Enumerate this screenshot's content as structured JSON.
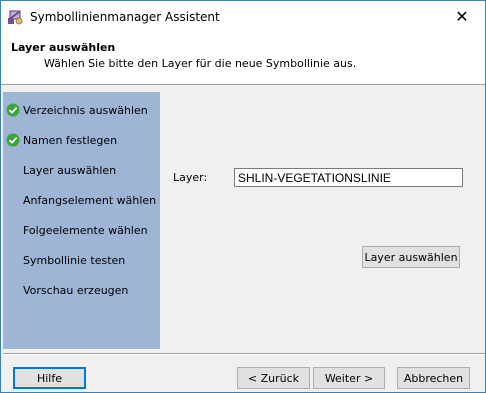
{
  "window": {
    "title": "Symbollinienmanager Assistent",
    "close_glyph": "✕"
  },
  "header": {
    "title": "Layer auswählen",
    "subtitle": "Wählen Sie bitte den Layer für die neue Symbollinie aus."
  },
  "steps": [
    {
      "label": "Verzeichnis auswählen",
      "completed": true
    },
    {
      "label": "Namen festlegen",
      "completed": true
    },
    {
      "label": "Layer auswählen",
      "completed": false
    },
    {
      "label": "Anfangselement wählen",
      "completed": false
    },
    {
      "label": "Folgeelemente wählen",
      "completed": false
    },
    {
      "label": "Symbollinie testen",
      "completed": false
    },
    {
      "label": "Vorschau erzeugen",
      "completed": false
    }
  ],
  "main": {
    "layer_label": "Layer:",
    "layer_value": "SHLIN-VEGETATIONSLINIE",
    "select_layer_button": "Layer auswählen"
  },
  "footer": {
    "help": "Hilfe",
    "back": "< Zurück",
    "next": "Weiter >",
    "cancel": "Abbrechen"
  },
  "colors": {
    "sidebar": "#9eb5d6",
    "check": "#3aa63a",
    "accent": "#0078d7"
  },
  "icons": {
    "app": "symbol-manager-icon",
    "close": "close-icon",
    "check": "checkmark-icon"
  }
}
